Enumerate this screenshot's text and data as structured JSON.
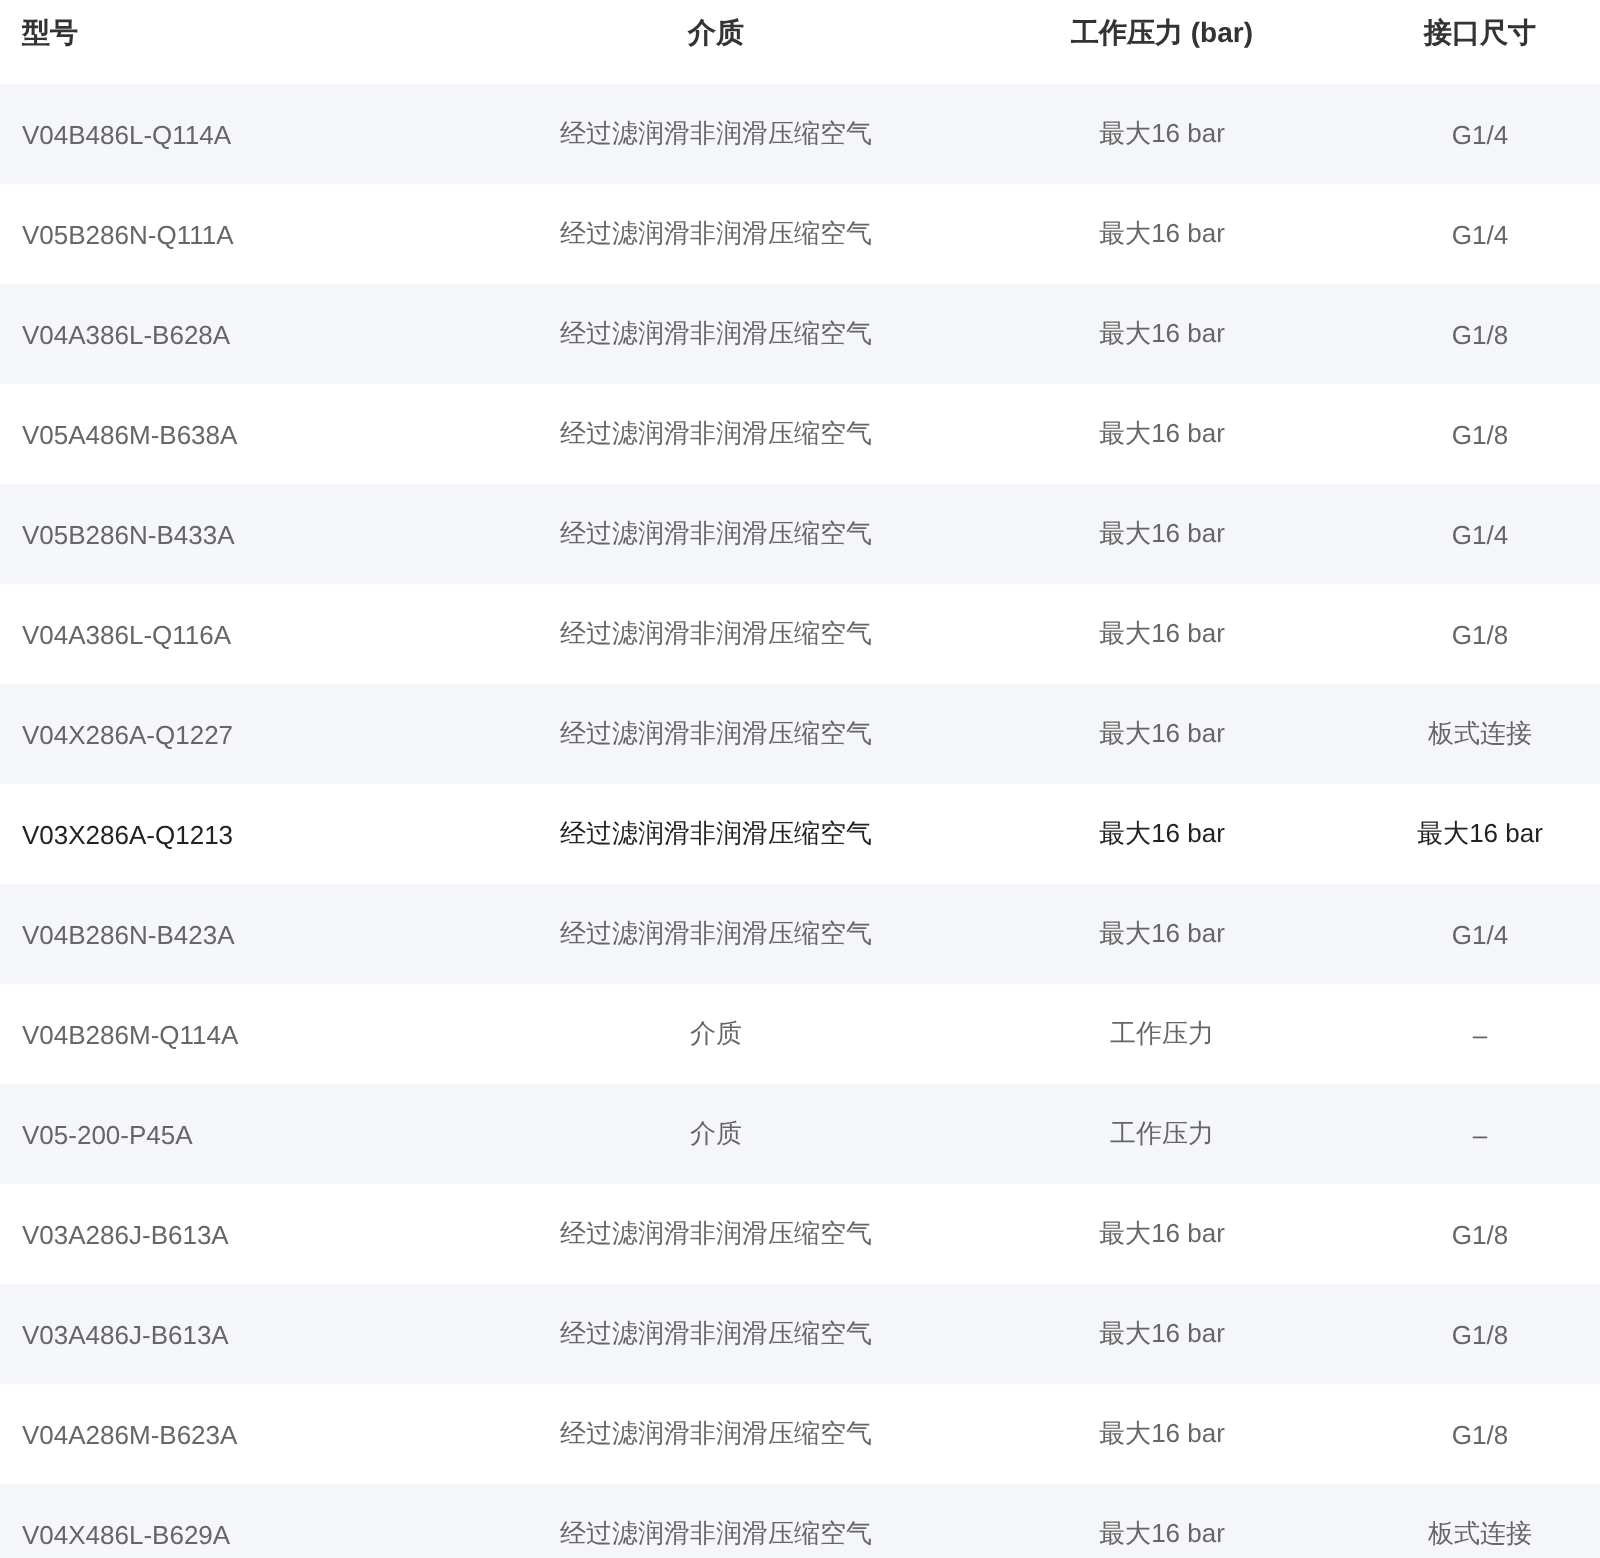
{
  "table": {
    "columns": [
      "型号",
      "介质",
      "工作压力 (bar)",
      "接口尺寸"
    ],
    "rows": [
      {
        "cells": [
          "V04B486L-Q114A",
          "经过滤润滑非润滑压缩空气",
          "最大16 bar",
          "G1/4"
        ],
        "highlighted": false
      },
      {
        "cells": [
          "V05B286N-Q111A",
          "经过滤润滑非润滑压缩空气",
          "最大16 bar",
          "G1/4"
        ],
        "highlighted": false
      },
      {
        "cells": [
          "V04A386L-B628A",
          "经过滤润滑非润滑压缩空气",
          "最大16 bar",
          "G1/8"
        ],
        "highlighted": false
      },
      {
        "cells": [
          "V05A486M-B638A",
          "经过滤润滑非润滑压缩空气",
          "最大16 bar",
          "G1/8"
        ],
        "highlighted": false
      },
      {
        "cells": [
          "V05B286N-B433A",
          "经过滤润滑非润滑压缩空气",
          "最大16 bar",
          "G1/4"
        ],
        "highlighted": false
      },
      {
        "cells": [
          "V04A386L-Q116A",
          "经过滤润滑非润滑压缩空气",
          "最大16 bar",
          "G1/8"
        ],
        "highlighted": false
      },
      {
        "cells": [
          "V04X286A-Q1227",
          "经过滤润滑非润滑压缩空气",
          "最大16 bar",
          "板式连接"
        ],
        "highlighted": false
      },
      {
        "cells": [
          "V03X286A-Q1213",
          "经过滤润滑非润滑压缩空气",
          "最大16 bar",
          "最大16 bar"
        ],
        "highlighted": true
      },
      {
        "cells": [
          "V04B286N-B423A",
          "经过滤润滑非润滑压缩空气",
          "最大16 bar",
          "G1/4"
        ],
        "highlighted": false
      },
      {
        "cells": [
          "V04B286M-Q114A",
          "介质",
          "工作压力",
          "–"
        ],
        "highlighted": false
      },
      {
        "cells": [
          "V05-200-P45A",
          "介质",
          "工作压力",
          "–"
        ],
        "highlighted": false
      },
      {
        "cells": [
          "V03A286J-B613A",
          "经过滤润滑非润滑压缩空气",
          "最大16 bar",
          "G1/8"
        ],
        "highlighted": false
      },
      {
        "cells": [
          "V03A486J-B613A",
          "经过滤润滑非润滑压缩空气",
          "最大16 bar",
          "G1/8"
        ],
        "highlighted": false
      },
      {
        "cells": [
          "V04A286M-B623A",
          "经过滤润滑非润滑压缩空气",
          "最大16 bar",
          "G1/8"
        ],
        "highlighted": false
      },
      {
        "cells": [
          "V04X486L-B629A",
          "经过滤润滑非润滑压缩空气",
          "最大16 bar",
          "板式连接"
        ],
        "highlighted": false
      }
    ]
  }
}
